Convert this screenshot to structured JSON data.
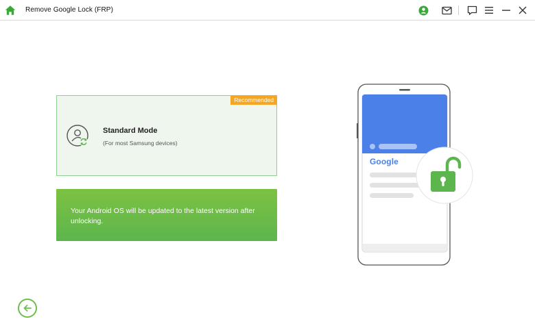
{
  "app": {
    "title": "Remove Google Lock (FRP)"
  },
  "titlebar": {
    "icons": [
      "home-icon",
      "account-icon",
      "mail-icon",
      "feedback-icon",
      "menu-icon",
      "minimize-icon",
      "close-icon"
    ]
  },
  "mode_card": {
    "badge": "Recommended",
    "title": "Standard Mode",
    "subtitle": "(For most Samsung devices)",
    "icon": "user-refresh-icon"
  },
  "notice": {
    "text": "Your Android OS will be updated to the latest version after unlocking."
  },
  "illustration": {
    "brand_text": "Google",
    "icon": "unlocked-padlock-icon"
  },
  "colors": {
    "accent_green": "#6cc04a",
    "card_bg": "#eef6ee",
    "card_border": "#8fcf8f",
    "badge_orange": "#f5a623",
    "phone_blue": "#4a80e8",
    "notice_green_top": "#7cc242",
    "notice_green_bottom": "#5db54d"
  }
}
